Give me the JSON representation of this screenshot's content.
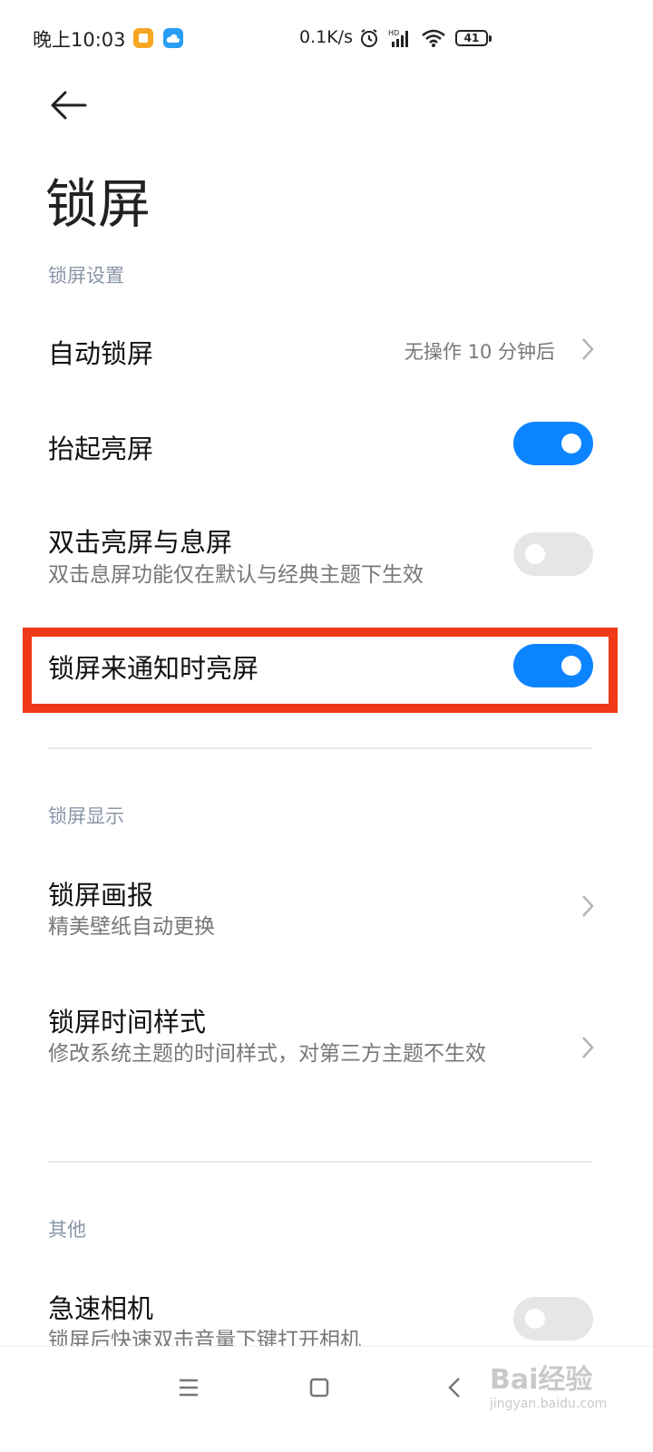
{
  "status_bar": {
    "time": "晚上10:03",
    "speed": "0.1K/s",
    "battery": "41",
    "icons": [
      "app-orange-icon",
      "cloud-app-icon",
      "alarm-icon",
      "hd-signal-icon",
      "wifi-icon",
      "battery-icon"
    ]
  },
  "header": {
    "title": "锁屏"
  },
  "sections": {
    "lock_settings": {
      "label": "锁屏设置",
      "auto_lock": {
        "title": "自动锁屏",
        "value": "无操作 10 分钟后"
      },
      "raise_to_wake": {
        "title": "抬起亮屏",
        "enabled": true
      },
      "double_tap": {
        "title": "双击亮屏与息屏",
        "subtitle": "双击息屏功能仅在默认与经典主题下生效",
        "enabled": false
      },
      "notify_wake": {
        "title": "锁屏来通知时亮屏",
        "enabled": true
      }
    },
    "lock_display": {
      "label": "锁屏显示",
      "wallpaper": {
        "title": "锁屏画报",
        "subtitle": "精美壁纸自动更换"
      },
      "clock_style": {
        "title": "锁屏时间样式",
        "subtitle": "修改系统主题的时间样式，对第三方主题不生效"
      }
    },
    "other": {
      "label": "其他",
      "quick_camera": {
        "title": "急速相机",
        "subtitle": "锁屏后快速双击音量下键打开相机",
        "enabled": false
      }
    }
  },
  "colors": {
    "toggle_on": "#0d84ff",
    "toggle_off": "#e6e6e6",
    "highlight": "#f03a17",
    "section_label": "#8a95a8"
  },
  "watermark": {
    "text": "Bai经验",
    "sub": "jingyan.baidu.com"
  }
}
